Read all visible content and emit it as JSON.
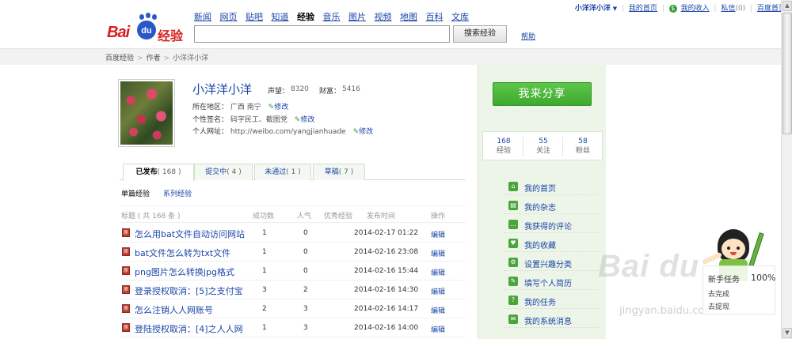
{
  "userbar": {
    "username": "小洋洋小洋",
    "my_home": "我的首页",
    "my_income": "我的收入",
    "messages": "私信",
    "messages_count": "(0)",
    "baidu_home": "百度首页"
  },
  "logo": {
    "bai": "Bai",
    "du": "du",
    "jy": "经验"
  },
  "nav": [
    "新闻",
    "网页",
    "贴吧",
    "知道",
    "经验",
    "音乐",
    "图片",
    "视频",
    "地图",
    "百科",
    "文库"
  ],
  "nav_active": "经验",
  "search": {
    "value": "",
    "button": "搜索经验",
    "help": "帮助"
  },
  "breadcrumb": [
    "百度经验",
    "作者",
    "小洋洋小洋"
  ],
  "profile": {
    "name": "小洋洋小洋",
    "reputation_label": "声望：",
    "reputation": "8320",
    "wealth_label": "财富：",
    "wealth": "5416",
    "region_label": "所在地区：",
    "region": "广西 南宁",
    "signature_label": "个性签名：",
    "signature": "码字民工、截图党",
    "url_label": "个人网址：",
    "url": "http://weibo.com/yangjianhuade",
    "edit": "修改"
  },
  "tabs": [
    {
      "label": "已发布",
      "count": "( 168 )"
    },
    {
      "label": "提交中",
      "count": "( 4 )"
    },
    {
      "label": "未通过",
      "count": "( 1 )"
    },
    {
      "label": "草稿",
      "count": "( 7 )"
    }
  ],
  "subtabs": [
    "单篇经验",
    "系列经验"
  ],
  "table": {
    "headers": [
      "标题 ( 共 168 条 )",
      "成功数",
      "人气",
      "优秀经验",
      "发布时间",
      "操作"
    ],
    "rows": [
      {
        "title": "怎么用bat文件自动访问网站",
        "success": "1",
        "pop": "0",
        "date": "2014-02-17 01:22",
        "action": "编辑"
      },
      {
        "title": "bat文件怎么转为txt文件",
        "success": "1",
        "pop": "0",
        "date": "2014-02-16 23:08",
        "action": "编辑"
      },
      {
        "title": "png图片怎么转换jpg格式",
        "success": "1",
        "pop": "0",
        "date": "2014-02-16 15:44",
        "action": "编辑"
      },
      {
        "title": "登录授权取消：[5]之支付宝",
        "success": "3",
        "pop": "2",
        "date": "2014-02-16 14:30",
        "action": "编辑"
      },
      {
        "title": "怎么注销人人网账号",
        "success": "2",
        "pop": "3",
        "date": "2014-02-16 14:17",
        "action": "编辑"
      },
      {
        "title": "登陆授权取消：[4]之人人网",
        "success": "1",
        "pop": "3",
        "date": "2014-02-16 14:00",
        "action": "编辑"
      }
    ],
    "doc_icon": "原"
  },
  "sidebar": {
    "share_button": "我来分享",
    "counts": [
      {
        "n": "168",
        "label": "经验"
      },
      {
        "n": "55",
        "label": "关注"
      },
      {
        "n": "58",
        "label": "粉丝"
      }
    ],
    "menu": [
      {
        "label": "我的首页",
        "icon": "home-icon"
      },
      {
        "label": "我的杂志",
        "icon": "magazine-icon"
      },
      {
        "label": "我获得的评论",
        "icon": "comment-icon"
      },
      {
        "label": "我的收藏",
        "icon": "favorite-icon"
      },
      {
        "label": "设置兴趣分类",
        "icon": "settings-icon"
      },
      {
        "label": "填写个人简历",
        "icon": "resume-icon"
      },
      {
        "label": "我的任务",
        "icon": "task-icon"
      },
      {
        "label": "我的系统消息",
        "icon": "message-icon"
      }
    ]
  },
  "watermark": {
    "logo": "Bai du",
    "url": "jingyan.baidu.com"
  },
  "widget": {
    "title": "新手任务",
    "percent": "100%",
    "line1": "去完成",
    "line2": "去提现"
  }
}
